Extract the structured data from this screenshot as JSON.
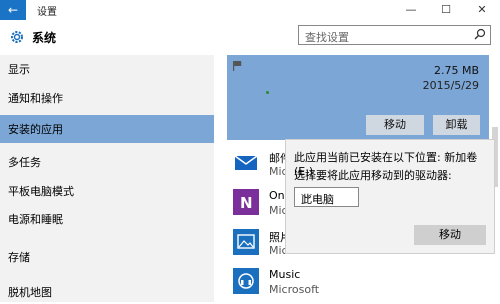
{
  "window": {
    "title": "设置",
    "back_glyph": "←",
    "min_glyph": "—",
    "max_glyph": "☐",
    "close_glyph": "✕"
  },
  "header": {
    "title": "系统",
    "search_placeholder": "查找设置"
  },
  "sidebar": {
    "items": [
      {
        "label": "显示",
        "active": false
      },
      {
        "label": "通知和操作",
        "active": false
      },
      {
        "label": "安装的应用",
        "active": true
      },
      {
        "label": "多任务",
        "active": false
      },
      {
        "label": "平板电脑模式",
        "active": false
      },
      {
        "label": "电源和睡眠",
        "active": false
      },
      {
        "label": "存储",
        "active": false
      },
      {
        "label": "脱机地图",
        "active": false
      }
    ]
  },
  "selected_app": {
    "size": "2.75 MB",
    "date": "2015/5/29",
    "move_label": "移动",
    "uninstall_label": "卸载"
  },
  "apps": [
    {
      "name": "邮件",
      "publisher": "Mic",
      "icon": "mail-icon",
      "color": "#1565c0"
    },
    {
      "name": "One",
      "publisher": "Mic",
      "icon": "onenote-icon",
      "color": "#7b2f9b"
    },
    {
      "name": "照片",
      "publisher": "Mic",
      "icon": "photos-icon",
      "color": "#1a6fbf"
    },
    {
      "name": "Music",
      "publisher": "Microsoft",
      "icon": "music-icon",
      "color": "#1a6fbf"
    }
  ],
  "popup": {
    "line1": "此应用当前已安装在以下位置: 新加卷 (E:)",
    "line2": "选择要将此应用移动到的驱动器:",
    "selected_drive": "此电脑",
    "move_label": "移动"
  },
  "colors": {
    "accent": "#1a73c4",
    "selection": "#7ba6d5",
    "sidebar_bg": "#f2f2f2"
  }
}
